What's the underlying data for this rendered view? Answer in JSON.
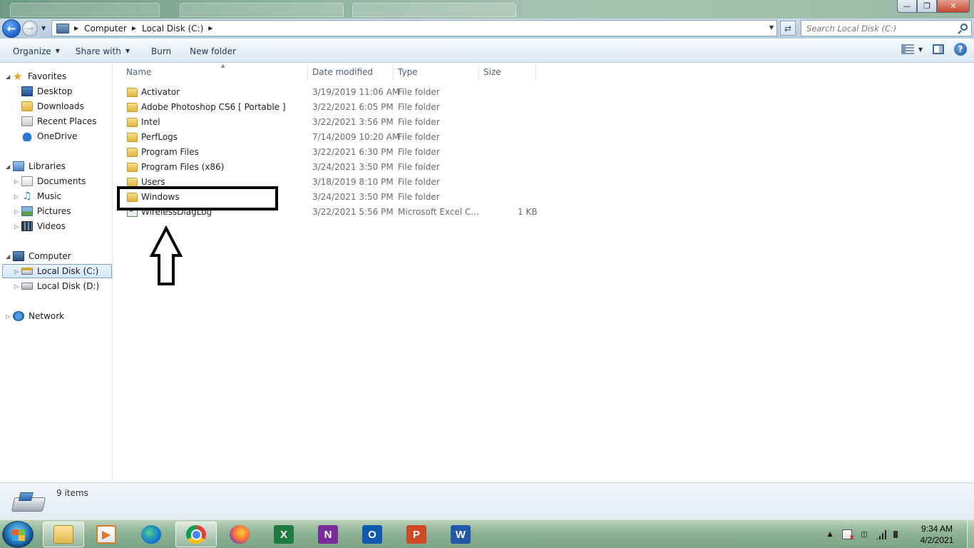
{
  "address": {
    "crumbs": [
      "Computer",
      "Local Disk (C:)"
    ],
    "search_placeholder": "Search Local Disk (C:)"
  },
  "toolbar": {
    "organize": "Organize",
    "share_with": "Share with",
    "burn": "Burn",
    "new_folder": "New folder"
  },
  "nav": {
    "favorites": "Favorites",
    "desktop": "Desktop",
    "downloads": "Downloads",
    "recent_places": "Recent Places",
    "onedrive": "OneDrive",
    "libraries": "Libraries",
    "documents": "Documents",
    "music": "Music",
    "pictures": "Pictures",
    "videos": "Videos",
    "computer": "Computer",
    "local_disk_c": "Local Disk (C:)",
    "local_disk_d": "Local Disk (D:)",
    "network": "Network"
  },
  "columns": {
    "name": "Name",
    "date_modified": "Date modified",
    "type": "Type",
    "size": "Size"
  },
  "files": [
    {
      "name": "Activator",
      "date": "3/19/2019 11:06 AM",
      "type": "File folder",
      "size": "",
      "icon": "folder-icon"
    },
    {
      "name": "Adobe Photoshop CS6 [ Portable ]",
      "date": "3/22/2021 6:05 PM",
      "type": "File folder",
      "size": "",
      "icon": "folder-icon"
    },
    {
      "name": "Intel",
      "date": "3/22/2021 3:56 PM",
      "type": "File folder",
      "size": "",
      "icon": "folder-icon"
    },
    {
      "name": "PerfLogs",
      "date": "7/14/2009 10:20 AM",
      "type": "File folder",
      "size": "",
      "icon": "folder-icon"
    },
    {
      "name": "Program Files",
      "date": "3/22/2021 6:30 PM",
      "type": "File folder",
      "size": "",
      "icon": "folder-icon"
    },
    {
      "name": "Program Files (x86)",
      "date": "3/24/2021 3:50 PM",
      "type": "File folder",
      "size": "",
      "icon": "folder-icon"
    },
    {
      "name": "Users",
      "date": "3/18/2019 8:10 PM",
      "type": "File folder",
      "size": "",
      "icon": "folder-icon"
    },
    {
      "name": "Windows",
      "date": "3/24/2021 3:50 PM",
      "type": "File folder",
      "size": "",
      "icon": "folder-icon"
    },
    {
      "name": "WirelessDiagLog",
      "date": "3/22/2021 5:56 PM",
      "type": "Microsoft Excel C...",
      "size": "1 KB",
      "icon": "excel-file-icon"
    }
  ],
  "details": {
    "item_count": "9 items"
  },
  "taskbar": {
    "time": "9:34 AM",
    "date": "4/2/2021",
    "apps": {
      "explorer": "",
      "media": "",
      "excel": "X",
      "onenote": "N",
      "outlook": "O",
      "powerpoint": "P",
      "word": "W"
    }
  },
  "colors": {
    "accent": "#1f5ec6",
    "selection": "#d3e7fb",
    "highlight_box": "#000000"
  }
}
